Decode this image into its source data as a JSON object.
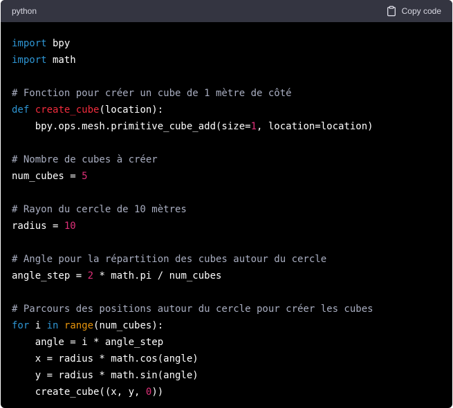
{
  "header": {
    "language": "python",
    "copy_label": "Copy code",
    "copy_icon": "clipboard-icon"
  },
  "code": {
    "lines": [
      [
        {
          "t": "import",
          "c": "kw"
        },
        {
          "t": " bpy",
          "c": ""
        }
      ],
      [
        {
          "t": "import",
          "c": "kw"
        },
        {
          "t": " math",
          "c": ""
        }
      ],
      [],
      [
        {
          "t": "# Fonction pour créer un cube de 1 mètre de côté",
          "c": "com"
        }
      ],
      [
        {
          "t": "def",
          "c": "kw"
        },
        {
          "t": " ",
          "c": ""
        },
        {
          "t": "create_cube",
          "c": "fn"
        },
        {
          "t": "(location):",
          "c": ""
        }
      ],
      [
        {
          "t": "    bpy.ops.mesh.primitive_cube_add(size=",
          "c": ""
        },
        {
          "t": "1",
          "c": "num"
        },
        {
          "t": ", location=location)",
          "c": ""
        }
      ],
      [],
      [
        {
          "t": "# Nombre de cubes à créer",
          "c": "com"
        }
      ],
      [
        {
          "t": "num_cubes = ",
          "c": ""
        },
        {
          "t": "5",
          "c": "num"
        }
      ],
      [],
      [
        {
          "t": "# Rayon du cercle de 10 mètres",
          "c": "com"
        }
      ],
      [
        {
          "t": "radius = ",
          "c": ""
        },
        {
          "t": "10",
          "c": "num"
        }
      ],
      [],
      [
        {
          "t": "# Angle pour la répartition des cubes autour du cercle",
          "c": "com"
        }
      ],
      [
        {
          "t": "angle_step = ",
          "c": ""
        },
        {
          "t": "2",
          "c": "num"
        },
        {
          "t": " * math.pi / num_cubes",
          "c": ""
        }
      ],
      [],
      [
        {
          "t": "# Parcours des positions autour du cercle pour créer les cubes",
          "c": "com"
        }
      ],
      [
        {
          "t": "for",
          "c": "kw"
        },
        {
          "t": " i ",
          "c": ""
        },
        {
          "t": "in",
          "c": "kw"
        },
        {
          "t": " ",
          "c": ""
        },
        {
          "t": "range",
          "c": "bi"
        },
        {
          "t": "(num_cubes):",
          "c": ""
        }
      ],
      [
        {
          "t": "    angle = i * angle_step",
          "c": ""
        }
      ],
      [
        {
          "t": "    x = radius * math.cos(angle)",
          "c": ""
        }
      ],
      [
        {
          "t": "    y = radius * math.sin(angle)",
          "c": ""
        }
      ],
      [
        {
          "t": "    create_cube((x, y, ",
          "c": ""
        },
        {
          "t": "0",
          "c": "num"
        },
        {
          "t": "))",
          "c": ""
        }
      ]
    ]
  }
}
